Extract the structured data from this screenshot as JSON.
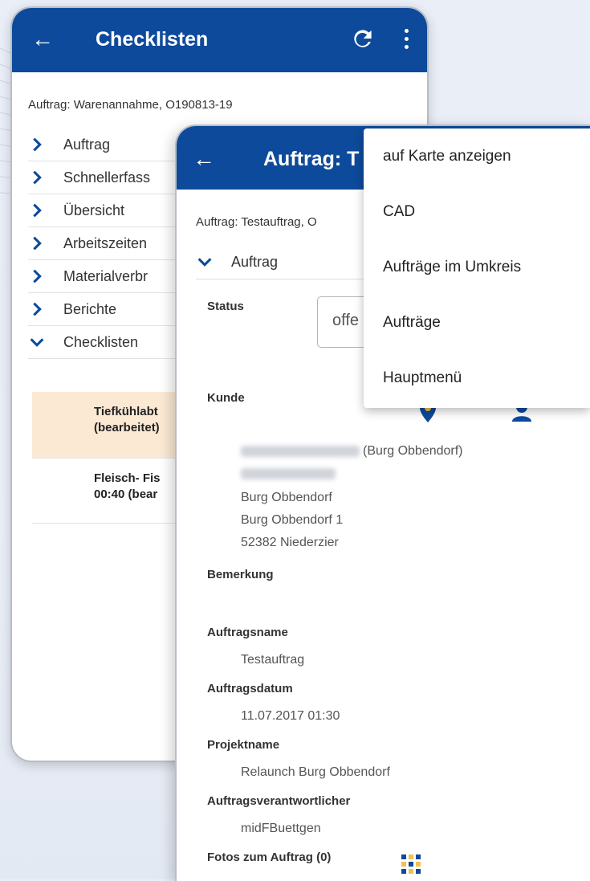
{
  "back_screen": {
    "title": "Checklisten",
    "order_line": "Auftrag: Warenannahme, O190813-19",
    "sections": [
      {
        "label": "Auftrag",
        "expanded": false
      },
      {
        "label": "Schnellerfass",
        "expanded": false
      },
      {
        "label": "Übersicht",
        "expanded": false
      },
      {
        "label": "Arbeitszeiten",
        "expanded": false
      },
      {
        "label": "Materialverbr",
        "expanded": false
      },
      {
        "label": "Berichte",
        "expanded": false
      },
      {
        "label": "Checklisten",
        "expanded": true
      }
    ],
    "checklist_items": [
      {
        "line1": "Tiefkühlabt",
        "line2": "(bearbeitet)"
      },
      {
        "line1": "Fleisch- Fis",
        "line2": "00:40 (bear"
      }
    ]
  },
  "front_screen": {
    "title": "Auftrag: T",
    "order_line": "Auftrag: Testauftrag, O",
    "section": "Auftrag",
    "status_label": "Status",
    "status_value": "offe",
    "customer_label": "Kunde",
    "customer_name_suffix": "(Burg Obbendorf)",
    "address": [
      "Burg Obbendorf",
      "Burg Obbendorf 1",
      "52382 Niederzier"
    ],
    "remark_label": "Bemerkung",
    "order_name_label": "Auftragsname",
    "order_name": "Testauftrag",
    "order_date_label": "Auftragsdatum",
    "order_date": "11.07.2017 01:30",
    "project_label": "Projektname",
    "project_name": "Relaunch Burg Obbendorf",
    "responsible_label": "Auftragsverantwortlicher",
    "responsible": "midFBuettgen",
    "photos_label": "Fotos zum Auftrag (0)"
  },
  "menu": {
    "items": [
      "auf Karte anzeigen",
      "CAD",
      "Aufträge im Umkreis",
      "Aufträge",
      "Hauptmenü"
    ]
  },
  "icons": {
    "back": "arrow-left-icon",
    "refresh": "refresh-icon",
    "overflow": "more-vertical-icon",
    "collapsed": "chevron-right-icon",
    "expanded": "chevron-down-icon",
    "map_pin": "map-pin-icon",
    "person": "person-icon",
    "photo_grid": "photo-grid-icon"
  },
  "colors": {
    "appbar": "#0d4a9b",
    "highlight_row": "#fbe9d4",
    "background": "#e9eef7"
  },
  "arrow_glyph": "←"
}
